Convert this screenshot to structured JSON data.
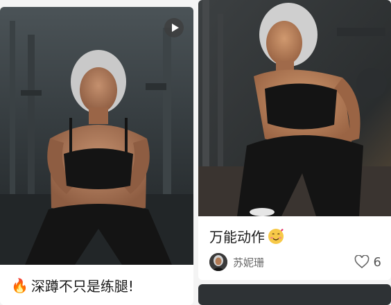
{
  "feed": {
    "cards": [
      {
        "title": "深蹲不只是练腿!",
        "emoji": "🔥",
        "has_video": true,
        "video_icon": "play-icon"
      },
      {
        "title": "万能动作",
        "emoji_icon": "smiling-face-with-hearts-icon",
        "author": "苏妮珊",
        "likes": "6",
        "like_icon": "heart-icon"
      }
    ]
  }
}
